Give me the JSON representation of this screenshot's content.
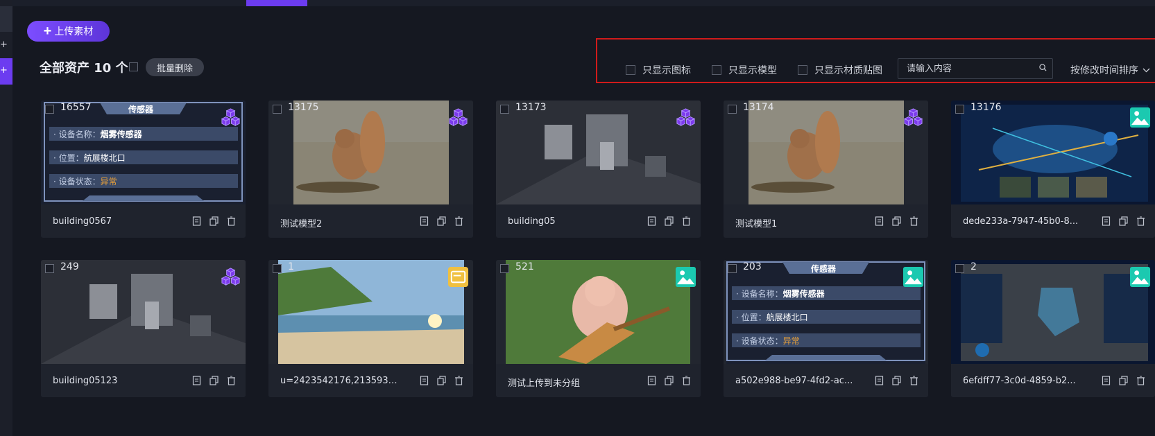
{
  "toolbar": {
    "upload_label": "上传素材",
    "batch_delete_label": "批量删除"
  },
  "header": {
    "title": "全部资产 10 个"
  },
  "filters": [
    {
      "label": "只显示图标"
    },
    {
      "label": "只显示模型"
    },
    {
      "label": "只显示材质贴图"
    }
  ],
  "search": {
    "placeholder": "请输入内容"
  },
  "sort": {
    "label": "按修改时间排序"
  },
  "sensor": {
    "title": "传感器",
    "field1": "设备名称：",
    "value1": "烟雾传感器",
    "field2": "位置：",
    "value2": "航展楼北口",
    "field3": "设备状态：",
    "value3": "异常"
  },
  "assets": [
    {
      "count": "16557",
      "name": "building0567",
      "badge": "model-icon"
    },
    {
      "count": "13175",
      "name": "测试模型2",
      "badge": "model-icon"
    },
    {
      "count": "13173",
      "name": "building05",
      "badge": "model-icon"
    },
    {
      "count": "13174",
      "name": "测试模型1",
      "badge": "model-icon"
    },
    {
      "count": "13176",
      "name": "dede233a-7947-45b0-8...",
      "badge": "image-icon"
    },
    {
      "count": "249",
      "name": "building05123",
      "badge": "model-icon"
    },
    {
      "count": "1",
      "name": "u=2423542176,2135932...",
      "badge": "texture-icon"
    },
    {
      "count": "521",
      "name": "测试上传到未分组",
      "badge": "image-icon"
    },
    {
      "count": "203",
      "name": "a502e988-be97-4fd2-ac...",
      "badge": "image-icon"
    },
    {
      "count": "2",
      "name": "6efdff77-3c0d-4859-b2...",
      "badge": "image-icon"
    }
  ],
  "colors": {
    "accent": "#6c3cf0",
    "highlight_box": "#d11b1b",
    "background": "#151821",
    "card": "#1f232d",
    "warning_text": "#e8a03a"
  }
}
